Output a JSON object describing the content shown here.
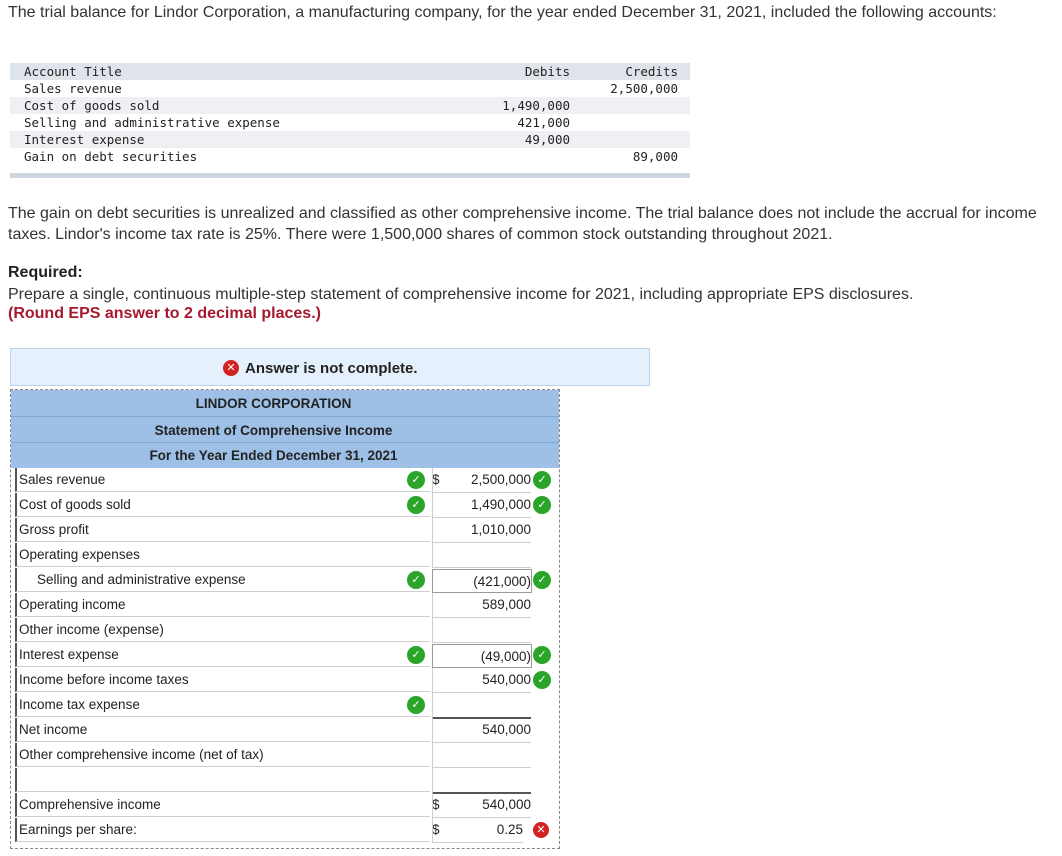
{
  "intro_text": "The trial balance for Lindor Corporation, a manufacturing company, for the year ended December 31, 2021, included the following accounts:",
  "trial_balance": {
    "headers": {
      "title": "Account Title",
      "debits": "Debits",
      "credits": "Credits"
    },
    "rows": [
      {
        "title": "Sales revenue",
        "debit": "",
        "credit": "2,500,000"
      },
      {
        "title": "Cost of goods sold",
        "debit": "1,490,000",
        "credit": ""
      },
      {
        "title": "Selling and administrative expense",
        "debit": "421,000",
        "credit": ""
      },
      {
        "title": "Interest expense",
        "debit": "49,000",
        "credit": ""
      },
      {
        "title": "Gain on debt securities",
        "debit": "",
        "credit": "89,000"
      }
    ]
  },
  "paragraph": "The gain on debt securities is unrealized and classified as other comprehensive income. The trial balance does not include the accrual for income taxes. Lindor's income tax rate is 25%. There were 1,500,000  shares of common stock outstanding throughout 2021.",
  "required": {
    "heading": "Required:",
    "text": "Prepare a single, continuous multiple-step statement of comprehensive income for 2021, including appropriate EPS disclosures.",
    "note": "(Round EPS answer to 2 decimal places.)"
  },
  "banner": {
    "text": "Answer is not complete.",
    "icon": "x-circle-icon",
    "color": "#d22222"
  },
  "statement": {
    "company": "LINDOR CORPORATION",
    "title": "Statement of Comprehensive Income",
    "period": "For the Year Ended December 31, 2021",
    "dollar": "$",
    "rows": [
      {
        "label": "Sales revenue",
        "amount": "2,500,000"
      },
      {
        "label": "Cost of goods sold",
        "amount": "1,490,000"
      },
      {
        "label": "Gross profit",
        "amount": "1,010,000"
      },
      {
        "label": "Operating expenses",
        "amount": ""
      },
      {
        "label": "Selling and administrative expense",
        "amount": "(421,000)"
      },
      {
        "label": "Operating income",
        "amount": "589,000"
      },
      {
        "label": "Other income (expense)",
        "amount": ""
      },
      {
        "label": "Interest expense",
        "amount": "(49,000)"
      },
      {
        "label": "Income before income taxes",
        "amount": "540,000"
      },
      {
        "label": "Income tax expense",
        "amount": ""
      },
      {
        "label": "Net income",
        "amount": "540,000"
      },
      {
        "label": "Other comprehensive income (net of tax)",
        "amount": ""
      },
      {
        "label": "",
        "amount": ""
      },
      {
        "label": "Comprehensive income",
        "amount": "540,000"
      },
      {
        "label": "Earnings per share:",
        "amount": "0.25"
      }
    ]
  },
  "colors": {
    "correct": "#2aa52a",
    "incorrect": "#d22222",
    "header_bg": "#9ec0e6",
    "note": "#a6192e"
  }
}
